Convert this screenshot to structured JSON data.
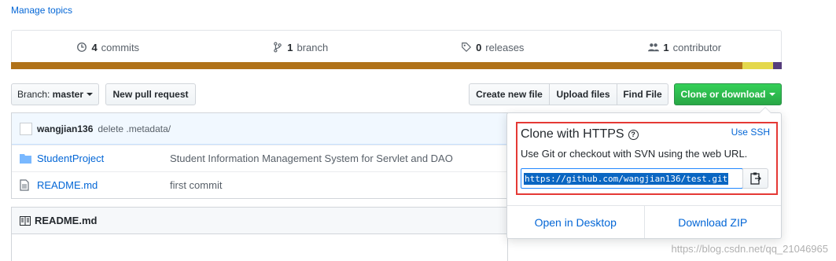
{
  "topics": {
    "manage_label": "Manage topics"
  },
  "stats": {
    "commits_count": "4",
    "commits_label": "commits",
    "branch_count": "1",
    "branch_label": "branch",
    "releases_count": "0",
    "releases_label": "releases",
    "contributor_count": "1",
    "contributor_label": "contributor"
  },
  "languages": [
    {
      "color": "#b07219",
      "percent": 94.9
    },
    {
      "color": "#e4d84c",
      "percent": 4.0
    },
    {
      "color": "#563d7c",
      "percent": 1.1
    }
  ],
  "toolbar": {
    "branch_prefix": "Branch:",
    "branch_name": "master",
    "new_pull_request": "New pull request",
    "create_new_file": "Create new file",
    "upload_files": "Upload files",
    "find_file": "Find File",
    "clone_or_download": "Clone or download"
  },
  "latest_commit": {
    "author": "wangjian136",
    "message": "delete .metadata/"
  },
  "files": [
    {
      "icon": "folder-icon",
      "name": "StudentProject",
      "description": "Student Information Management System for Servlet and DAO"
    },
    {
      "icon": "file-icon",
      "name": "README.md",
      "description": "first commit"
    }
  ],
  "readme": {
    "title": "README.md"
  },
  "clone": {
    "title": "Clone with HTTPS",
    "use_ssh": "Use SSH",
    "description": "Use Git or checkout with SVN using the web URL.",
    "url": "https://github.com/wangjian136/test.git",
    "open_desktop": "Open in Desktop",
    "download_zip": "Download ZIP"
  },
  "watermark": "https://blog.csdn.net/qq_21046965"
}
